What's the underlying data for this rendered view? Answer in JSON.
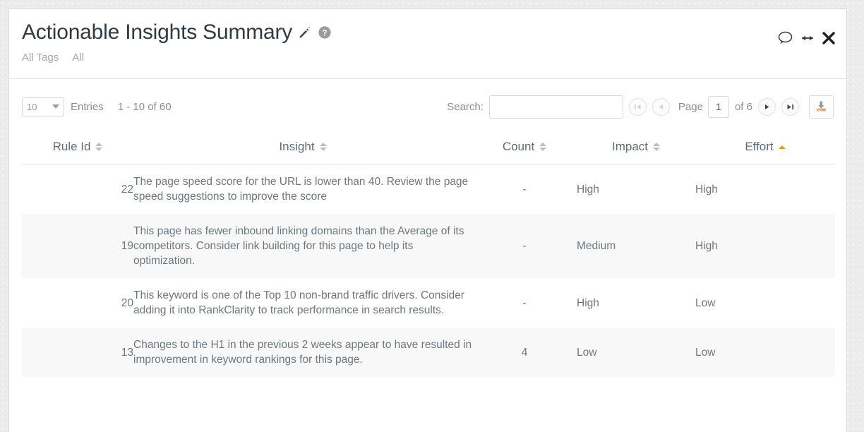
{
  "header": {
    "title": "Actionable Insights Summary",
    "edit_icon": "pencil-icon",
    "help_icon": "help-circle-icon",
    "filters": [
      "All Tags",
      "All"
    ],
    "actions": [
      "comment-icon",
      "resize-horizontal-icon",
      "close-icon"
    ]
  },
  "toolbar": {
    "entries_value": "10",
    "entries_label": "Entries",
    "entries_range": "1 - 10 of 60",
    "search_label": "Search:",
    "search_value": "",
    "search_placeholder": "",
    "page_label": "Page",
    "page_value": "1",
    "page_of": "of 6",
    "first_page_title": "first-page",
    "prev_page_title": "previous-page",
    "next_page_title": "next-page",
    "last_page_title": "last-page",
    "download_title": "download-export"
  },
  "table": {
    "columns": [
      {
        "label": "Rule Id",
        "sort": "none"
      },
      {
        "label": "Insight",
        "sort": "none"
      },
      {
        "label": "Count",
        "sort": "none"
      },
      {
        "label": "Impact",
        "sort": "none"
      },
      {
        "label": "Effort",
        "sort": "asc"
      }
    ],
    "rows": [
      {
        "rule_id": "22",
        "insight": "The page speed score for the URL is lower than 40. Review the page speed suggestions to improve the score",
        "count": "-",
        "impact": "High",
        "effort": "High"
      },
      {
        "rule_id": "19",
        "insight": "This page has fewer inbound linking domains than the Average of its competitors. Consider link building for this page to help its optimization.",
        "count": "-",
        "impact": "Medium",
        "effort": "High"
      },
      {
        "rule_id": "20",
        "insight": "This keyword is one of the Top 10 non-brand traffic drivers. Consider adding it into RankClarity to track performance in search results.",
        "count": "-",
        "impact": "High",
        "effort": "Low"
      },
      {
        "rule_id": "13",
        "insight": "Changes to the H1 in the previous 2 weeks appear to have resulted in improvement in keyword rankings for this page.",
        "count": "4",
        "impact": "Low",
        "effort": "Low"
      }
    ]
  },
  "colors": {
    "accent": "#f5921e",
    "heading": "#2f3b44",
    "muted": "#8d8d8d",
    "body_text": "#6b7880"
  }
}
